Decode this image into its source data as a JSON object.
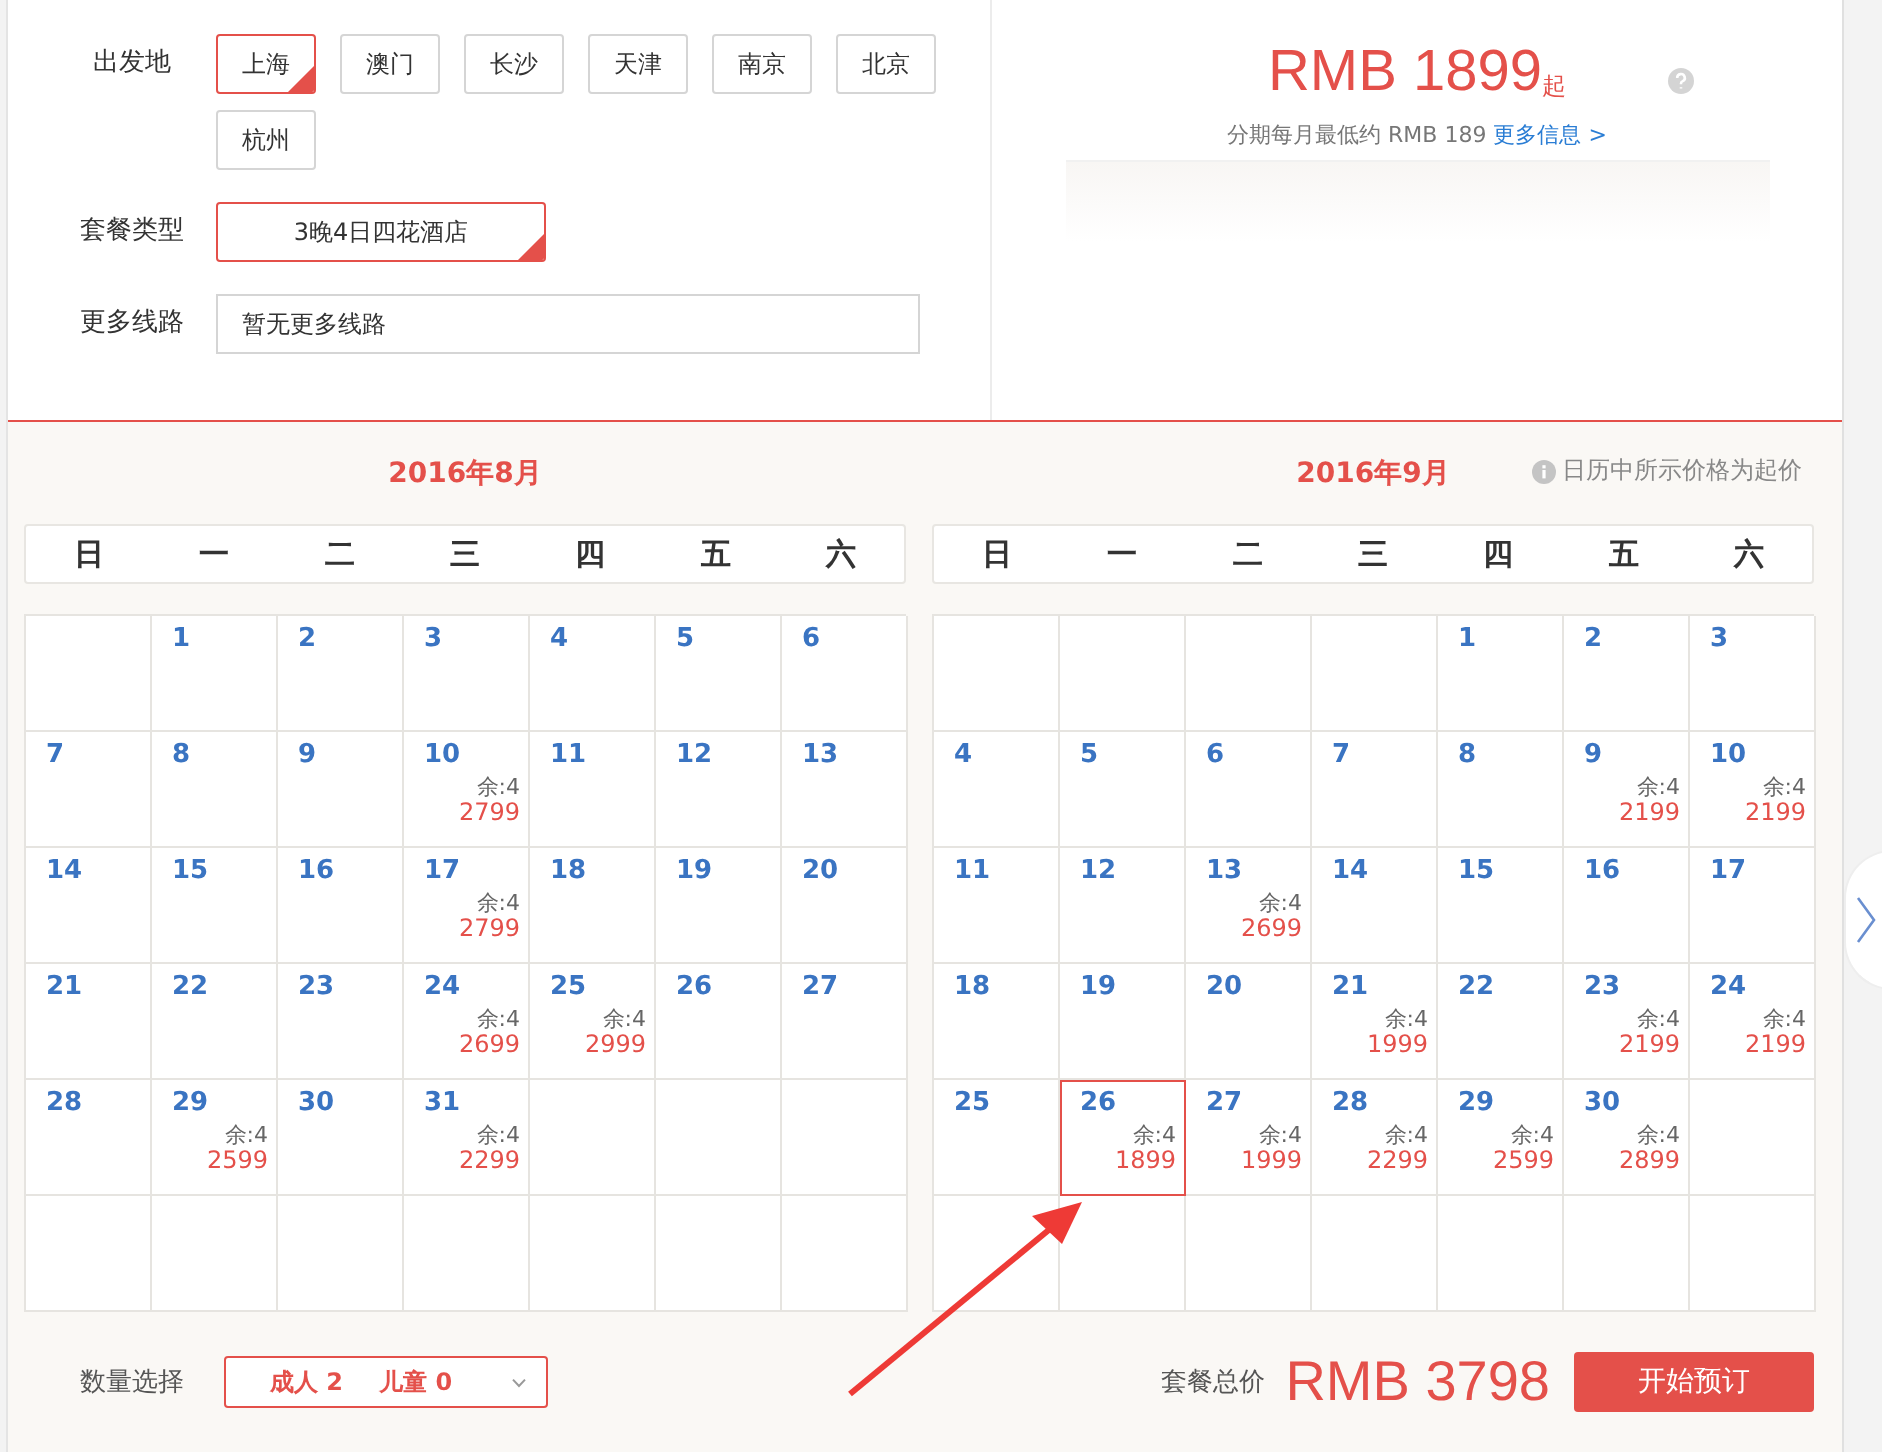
{
  "origin": {
    "label": "出发地",
    "options": [
      {
        "label": "上海",
        "selected": true
      },
      {
        "label": "澳门",
        "selected": false
      },
      {
        "label": "长沙",
        "selected": false
      },
      {
        "label": "天津",
        "selected": false
      },
      {
        "label": "南京",
        "selected": false
      },
      {
        "label": "北京",
        "selected": false
      },
      {
        "label": "杭州",
        "selected": false
      }
    ]
  },
  "package_type": {
    "label": "套餐类型",
    "options": [
      {
        "label": "3晚4日四花酒店",
        "selected": true
      }
    ]
  },
  "more_routes": {
    "label": "更多线路",
    "value": "暂无更多线路"
  },
  "price_summary": {
    "price": "RMB 1899",
    "suffix": "起",
    "installment": "分期每月最低约 RMB 189",
    "more_link": "更多信息 >"
  },
  "calendar_note": "日历中所示价格为起价",
  "months": [
    {
      "title": "2016年8月",
      "weekdays": [
        "日",
        "一",
        "二",
        "三",
        "四",
        "五",
        "六"
      ],
      "weeks": [
        [
          {
            "kind": "blank"
          },
          {
            "kind": "date",
            "day": "1",
            "selected": false
          },
          {
            "kind": "date",
            "day": "2",
            "selected": false
          },
          {
            "kind": "date",
            "day": "3",
            "selected": false
          },
          {
            "kind": "date",
            "day": "4",
            "selected": false
          },
          {
            "kind": "date",
            "day": "5",
            "selected": false
          },
          {
            "kind": "date",
            "day": "6",
            "selected": false
          }
        ],
        [
          {
            "kind": "date",
            "day": "7",
            "selected": false
          },
          {
            "kind": "date",
            "day": "8",
            "selected": false
          },
          {
            "kind": "date",
            "day": "9",
            "selected": false
          },
          {
            "kind": "date",
            "day": "10",
            "remaining": "余:4",
            "price": "2799",
            "selected": false
          },
          {
            "kind": "date",
            "day": "11",
            "selected": false
          },
          {
            "kind": "date",
            "day": "12",
            "selected": false
          },
          {
            "kind": "date",
            "day": "13",
            "selected": false
          }
        ],
        [
          {
            "kind": "date",
            "day": "14",
            "selected": false
          },
          {
            "kind": "date",
            "day": "15",
            "selected": false
          },
          {
            "kind": "date",
            "day": "16",
            "selected": false
          },
          {
            "kind": "date",
            "day": "17",
            "remaining": "余:4",
            "price": "2799",
            "selected": false
          },
          {
            "kind": "date",
            "day": "18",
            "selected": false
          },
          {
            "kind": "date",
            "day": "19",
            "selected": false
          },
          {
            "kind": "date",
            "day": "20",
            "selected": false
          }
        ],
        [
          {
            "kind": "date",
            "day": "21",
            "selected": false
          },
          {
            "kind": "date",
            "day": "22",
            "selected": false
          },
          {
            "kind": "date",
            "day": "23",
            "selected": false
          },
          {
            "kind": "date",
            "day": "24",
            "remaining": "余:4",
            "price": "2699",
            "selected": false
          },
          {
            "kind": "date",
            "day": "25",
            "remaining": "余:4",
            "price": "2999",
            "selected": false
          },
          {
            "kind": "date",
            "day": "26",
            "selected": false
          },
          {
            "kind": "date",
            "day": "27",
            "selected": false
          }
        ],
        [
          {
            "kind": "date",
            "day": "28",
            "selected": false
          },
          {
            "kind": "date",
            "day": "29",
            "remaining": "余:4",
            "price": "2599",
            "selected": false
          },
          {
            "kind": "date",
            "day": "30",
            "selected": false
          },
          {
            "kind": "date",
            "day": "31",
            "remaining": "余:4",
            "price": "2299",
            "selected": false
          },
          {
            "kind": "blank"
          },
          {
            "kind": "blank"
          },
          {
            "kind": "blank"
          }
        ],
        [
          {
            "kind": "blank"
          },
          {
            "kind": "blank"
          },
          {
            "kind": "blank"
          },
          {
            "kind": "blank"
          },
          {
            "kind": "blank"
          },
          {
            "kind": "blank"
          },
          {
            "kind": "blank"
          }
        ]
      ]
    },
    {
      "title": "2016年9月",
      "weekdays": [
        "日",
        "一",
        "二",
        "三",
        "四",
        "五",
        "六"
      ],
      "weeks": [
        [
          {
            "kind": "blank"
          },
          {
            "kind": "blank"
          },
          {
            "kind": "blank"
          },
          {
            "kind": "blank"
          },
          {
            "kind": "date",
            "day": "1",
            "selected": false
          },
          {
            "kind": "date",
            "day": "2",
            "selected": false
          },
          {
            "kind": "date",
            "day": "3",
            "selected": false
          }
        ],
        [
          {
            "kind": "date",
            "day": "4",
            "selected": false
          },
          {
            "kind": "date",
            "day": "5",
            "selected": false
          },
          {
            "kind": "date",
            "day": "6",
            "selected": false
          },
          {
            "kind": "date",
            "day": "7",
            "selected": false
          },
          {
            "kind": "date",
            "day": "8",
            "selected": false
          },
          {
            "kind": "date",
            "day": "9",
            "remaining": "余:4",
            "price": "2199",
            "selected": false
          },
          {
            "kind": "date",
            "day": "10",
            "remaining": "余:4",
            "price": "2199",
            "selected": false
          }
        ],
        [
          {
            "kind": "date",
            "day": "11",
            "selected": false
          },
          {
            "kind": "date",
            "day": "12",
            "selected": false
          },
          {
            "kind": "date",
            "day": "13",
            "remaining": "余:4",
            "price": "2699",
            "selected": false
          },
          {
            "kind": "date",
            "day": "14",
            "selected": false
          },
          {
            "kind": "date",
            "day": "15",
            "selected": false
          },
          {
            "kind": "date",
            "day": "16",
            "selected": false
          },
          {
            "kind": "date",
            "day": "17",
            "selected": false
          }
        ],
        [
          {
            "kind": "date",
            "day": "18",
            "selected": false
          },
          {
            "kind": "date",
            "day": "19",
            "selected": false
          },
          {
            "kind": "date",
            "day": "20",
            "selected": false
          },
          {
            "kind": "date",
            "day": "21",
            "remaining": "余:4",
            "price": "1999",
            "selected": false
          },
          {
            "kind": "date",
            "day": "22",
            "selected": false
          },
          {
            "kind": "date",
            "day": "23",
            "remaining": "余:4",
            "price": "2199",
            "selected": false
          },
          {
            "kind": "date",
            "day": "24",
            "remaining": "余:4",
            "price": "2199",
            "selected": false
          }
        ],
        [
          {
            "kind": "date",
            "day": "25",
            "selected": false
          },
          {
            "kind": "date",
            "day": "26",
            "remaining": "余:4",
            "price": "1899",
            "selected": true
          },
          {
            "kind": "date",
            "day": "27",
            "remaining": "余:4",
            "price": "1999",
            "selected": false
          },
          {
            "kind": "date",
            "day": "28",
            "remaining": "余:4",
            "price": "2299",
            "selected": false
          },
          {
            "kind": "date",
            "day": "29",
            "remaining": "余:4",
            "price": "2599",
            "selected": false
          },
          {
            "kind": "date",
            "day": "30",
            "remaining": "余:4",
            "price": "2899",
            "selected": false
          },
          {
            "kind": "blank"
          }
        ],
        [
          {
            "kind": "blank"
          },
          {
            "kind": "blank"
          },
          {
            "kind": "blank"
          },
          {
            "kind": "blank"
          },
          {
            "kind": "blank"
          },
          {
            "kind": "blank"
          },
          {
            "kind": "blank"
          }
        ]
      ]
    }
  ],
  "quantity": {
    "label": "数量选择",
    "adults": "成人 2",
    "children": "儿童 0"
  },
  "total": {
    "label": "套餐总价",
    "price": "RMB 3798"
  },
  "book_button": "开始预订"
}
